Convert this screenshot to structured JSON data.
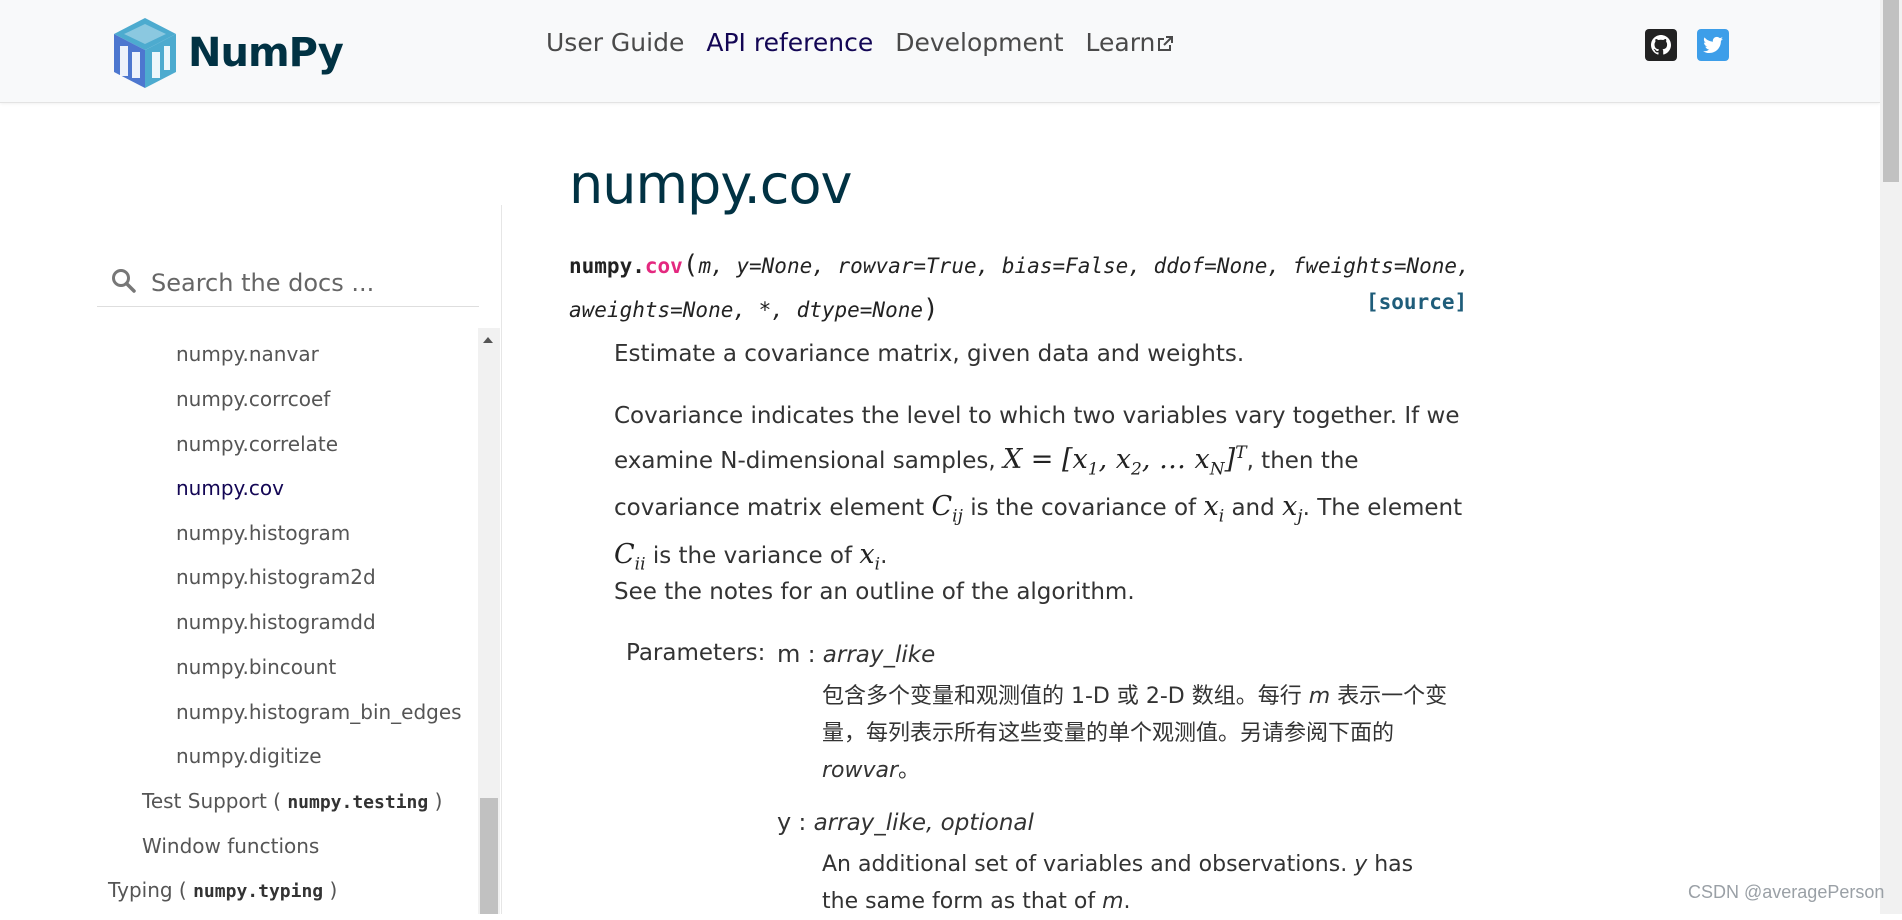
{
  "brand": {
    "name": "NumPy"
  },
  "nav": {
    "links": [
      "User Guide",
      "API reference",
      "Development",
      "Learn"
    ],
    "active": "API reference"
  },
  "search": {
    "placeholder": "Search the docs ..."
  },
  "sidebar": {
    "items": [
      {
        "label": "numpy.nanvar"
      },
      {
        "label": "numpy.corrcoef"
      },
      {
        "label": "numpy.correlate"
      },
      {
        "label": "numpy.cov",
        "active": true
      },
      {
        "label": "numpy.histogram"
      },
      {
        "label": "numpy.histogram2d"
      },
      {
        "label": "numpy.histogramdd"
      },
      {
        "label": "numpy.bincount"
      },
      {
        "label": "numpy.histogram_bin_edges"
      },
      {
        "label": "numpy.digitize"
      }
    ],
    "test_support": {
      "prefix": "Test Support (",
      "code": "numpy.testing",
      "suffix": ")"
    },
    "window_functions": "Window functions",
    "typing": {
      "prefix": "Typing (",
      "code": "numpy.typing",
      "suffix": ")"
    }
  },
  "main": {
    "title": "numpy.cov",
    "signature": {
      "module": "numpy.",
      "func": "cov",
      "line1": "m, y=None, rowvar=True, bias=False, ddof=None, fweights=None,",
      "line2": "aweights=None, *, dtype=None"
    },
    "source_link": "[source]",
    "summary": "Estimate a covariance matrix, given data and weights.",
    "desc": {
      "part1": "Covariance indicates the level to which two variables vary together. If we examine N-dimensional samples, ",
      "part2": ", then the covariance matrix element ",
      "part3": " is the covariance of ",
      "part4": " and ",
      "part5": ". The element ",
      "part6": " is the variance of ",
      "part7": "."
    },
    "notes": "See the notes for an outline of the algorithm.",
    "parameters_label": "Parameters:",
    "params": [
      {
        "name": "m",
        "sep": " : ",
        "type": "array_like",
        "desc_a": "包含多个变量和观测值的 1-D 或 2-D 数组。每行 ",
        "desc_em": "m",
        "desc_b": " 表示一个变量，每列表示所有这些变量的单个观测值。另请参阅下面的",
        "desc_em2": "rowvar",
        "desc_c": "。"
      },
      {
        "name": "y",
        "sep": " : ",
        "type": "array_like, optional",
        "desc_a": "An additional set of variables and observations. ",
        "desc_em": "y",
        "desc_b": " has the same form as that of ",
        "desc_em2": "m",
        "desc_c": "."
      }
    ]
  },
  "watermark": "CSDN @averagePerson",
  "colors": {
    "accent": "#130654",
    "function": "#e4287f",
    "title": "#013243",
    "twitter": "#3d9ee9"
  }
}
